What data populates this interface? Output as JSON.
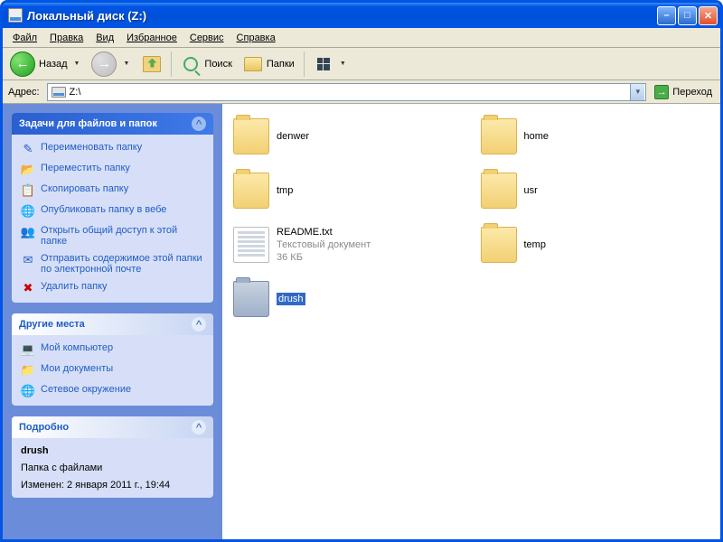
{
  "window": {
    "title": "Локальный диск (Z:)"
  },
  "menu": {
    "file": "Файл",
    "edit": "Правка",
    "view": "Вид",
    "favorites": "Избранное",
    "tools": "Сервис",
    "help": "Справка"
  },
  "toolbar": {
    "back": "Назад",
    "search": "Поиск",
    "folders": "Папки"
  },
  "address": {
    "label": "Адрес:",
    "value": "Z:\\",
    "go": "Переход"
  },
  "sidebar": {
    "tasks": {
      "title": "Задачи для файлов и папок",
      "items": [
        "Переименовать папку",
        "Переместить папку",
        "Скопировать папку",
        "Опубликовать папку в вебе",
        "Открыть общий доступ к этой папке",
        "Отправить содержимое этой папки по электронной почте",
        "Удалить папку"
      ]
    },
    "places": {
      "title": "Другие места",
      "items": [
        "Мой компьютер",
        "Мои документы",
        "Сетевое окружение"
      ]
    },
    "details": {
      "title": "Подробно",
      "name": "drush",
      "type": "Папка с файлами",
      "modified": "Изменен: 2 января 2011 г., 19:44"
    }
  },
  "files": {
    "denwer": {
      "name": "denwer"
    },
    "home": {
      "name": "home"
    },
    "tmp": {
      "name": "tmp"
    },
    "usr": {
      "name": "usr"
    },
    "readme": {
      "name": "README.txt",
      "type": "Текстовый документ",
      "size": "36 КБ"
    },
    "temp": {
      "name": "temp"
    },
    "drush": {
      "name": "drush"
    }
  }
}
